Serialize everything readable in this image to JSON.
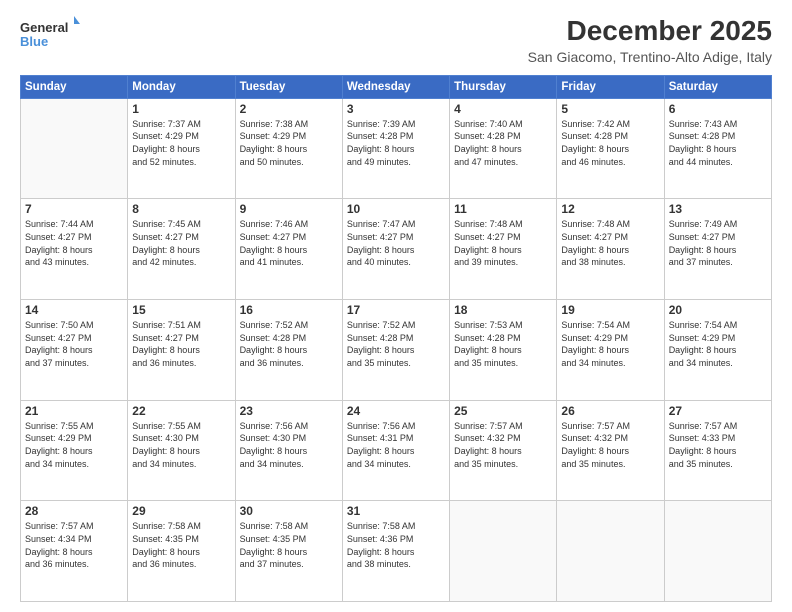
{
  "logo": {
    "general": "General",
    "blue": "Blue"
  },
  "title": {
    "main": "December 2025",
    "sub": "San Giacomo, Trentino-Alto Adige, Italy"
  },
  "calendar": {
    "headers": [
      "Sunday",
      "Monday",
      "Tuesday",
      "Wednesday",
      "Thursday",
      "Friday",
      "Saturday"
    ],
    "weeks": [
      {
        "days": [
          {
            "num": "",
            "info": ""
          },
          {
            "num": "1",
            "info": "Sunrise: 7:37 AM\nSunset: 4:29 PM\nDaylight: 8 hours\nand 52 minutes."
          },
          {
            "num": "2",
            "info": "Sunrise: 7:38 AM\nSunset: 4:29 PM\nDaylight: 8 hours\nand 50 minutes."
          },
          {
            "num": "3",
            "info": "Sunrise: 7:39 AM\nSunset: 4:28 PM\nDaylight: 8 hours\nand 49 minutes."
          },
          {
            "num": "4",
            "info": "Sunrise: 7:40 AM\nSunset: 4:28 PM\nDaylight: 8 hours\nand 47 minutes."
          },
          {
            "num": "5",
            "info": "Sunrise: 7:42 AM\nSunset: 4:28 PM\nDaylight: 8 hours\nand 46 minutes."
          },
          {
            "num": "6",
            "info": "Sunrise: 7:43 AM\nSunset: 4:28 PM\nDaylight: 8 hours\nand 44 minutes."
          }
        ]
      },
      {
        "days": [
          {
            "num": "7",
            "info": "Sunrise: 7:44 AM\nSunset: 4:27 PM\nDaylight: 8 hours\nand 43 minutes."
          },
          {
            "num": "8",
            "info": "Sunrise: 7:45 AM\nSunset: 4:27 PM\nDaylight: 8 hours\nand 42 minutes."
          },
          {
            "num": "9",
            "info": "Sunrise: 7:46 AM\nSunset: 4:27 PM\nDaylight: 8 hours\nand 41 minutes."
          },
          {
            "num": "10",
            "info": "Sunrise: 7:47 AM\nSunset: 4:27 PM\nDaylight: 8 hours\nand 40 minutes."
          },
          {
            "num": "11",
            "info": "Sunrise: 7:48 AM\nSunset: 4:27 PM\nDaylight: 8 hours\nand 39 minutes."
          },
          {
            "num": "12",
            "info": "Sunrise: 7:48 AM\nSunset: 4:27 PM\nDaylight: 8 hours\nand 38 minutes."
          },
          {
            "num": "13",
            "info": "Sunrise: 7:49 AM\nSunset: 4:27 PM\nDaylight: 8 hours\nand 37 minutes."
          }
        ]
      },
      {
        "days": [
          {
            "num": "14",
            "info": "Sunrise: 7:50 AM\nSunset: 4:27 PM\nDaylight: 8 hours\nand 37 minutes."
          },
          {
            "num": "15",
            "info": "Sunrise: 7:51 AM\nSunset: 4:27 PM\nDaylight: 8 hours\nand 36 minutes."
          },
          {
            "num": "16",
            "info": "Sunrise: 7:52 AM\nSunset: 4:28 PM\nDaylight: 8 hours\nand 36 minutes."
          },
          {
            "num": "17",
            "info": "Sunrise: 7:52 AM\nSunset: 4:28 PM\nDaylight: 8 hours\nand 35 minutes."
          },
          {
            "num": "18",
            "info": "Sunrise: 7:53 AM\nSunset: 4:28 PM\nDaylight: 8 hours\nand 35 minutes."
          },
          {
            "num": "19",
            "info": "Sunrise: 7:54 AM\nSunset: 4:29 PM\nDaylight: 8 hours\nand 34 minutes."
          },
          {
            "num": "20",
            "info": "Sunrise: 7:54 AM\nSunset: 4:29 PM\nDaylight: 8 hours\nand 34 minutes."
          }
        ]
      },
      {
        "days": [
          {
            "num": "21",
            "info": "Sunrise: 7:55 AM\nSunset: 4:29 PM\nDaylight: 8 hours\nand 34 minutes."
          },
          {
            "num": "22",
            "info": "Sunrise: 7:55 AM\nSunset: 4:30 PM\nDaylight: 8 hours\nand 34 minutes."
          },
          {
            "num": "23",
            "info": "Sunrise: 7:56 AM\nSunset: 4:30 PM\nDaylight: 8 hours\nand 34 minutes."
          },
          {
            "num": "24",
            "info": "Sunrise: 7:56 AM\nSunset: 4:31 PM\nDaylight: 8 hours\nand 34 minutes."
          },
          {
            "num": "25",
            "info": "Sunrise: 7:57 AM\nSunset: 4:32 PM\nDaylight: 8 hours\nand 35 minutes."
          },
          {
            "num": "26",
            "info": "Sunrise: 7:57 AM\nSunset: 4:32 PM\nDaylight: 8 hours\nand 35 minutes."
          },
          {
            "num": "27",
            "info": "Sunrise: 7:57 AM\nSunset: 4:33 PM\nDaylight: 8 hours\nand 35 minutes."
          }
        ]
      },
      {
        "days": [
          {
            "num": "28",
            "info": "Sunrise: 7:57 AM\nSunset: 4:34 PM\nDaylight: 8 hours\nand 36 minutes."
          },
          {
            "num": "29",
            "info": "Sunrise: 7:58 AM\nSunset: 4:35 PM\nDaylight: 8 hours\nand 36 minutes."
          },
          {
            "num": "30",
            "info": "Sunrise: 7:58 AM\nSunset: 4:35 PM\nDaylight: 8 hours\nand 37 minutes."
          },
          {
            "num": "31",
            "info": "Sunrise: 7:58 AM\nSunset: 4:36 PM\nDaylight: 8 hours\nand 38 minutes."
          },
          {
            "num": "",
            "info": ""
          },
          {
            "num": "",
            "info": ""
          },
          {
            "num": "",
            "info": ""
          }
        ]
      }
    ]
  }
}
